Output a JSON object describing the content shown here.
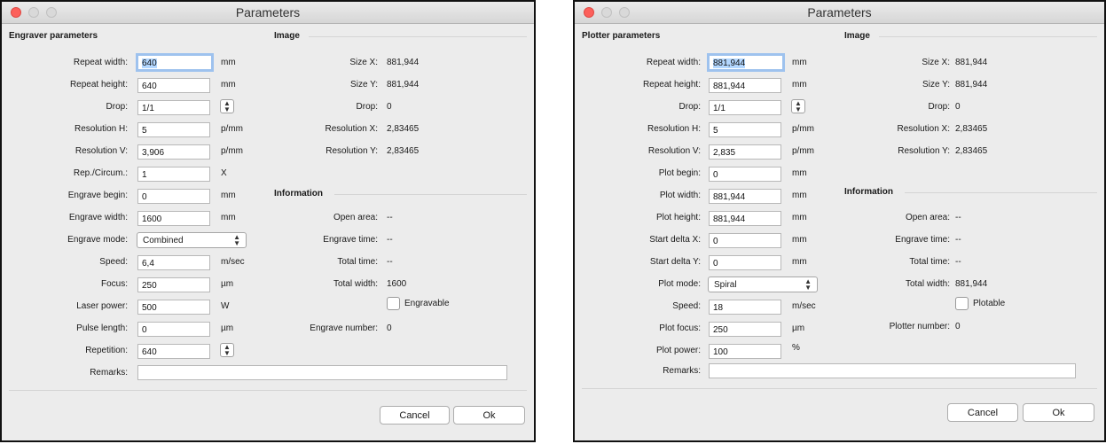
{
  "engraver": {
    "title": "Parameters",
    "left_section": "Engraver parameters",
    "image_section": "Image",
    "info_section": "Information",
    "fields": [
      {
        "label": "Repeat width:",
        "value": "640",
        "unit": "mm"
      },
      {
        "label": "Repeat height:",
        "value": "640",
        "unit": "mm"
      },
      {
        "label": "Drop:",
        "value": "1/1",
        "unit": ""
      },
      {
        "label": "Resolution H:",
        "value": "5",
        "unit": "p/mm"
      },
      {
        "label": "Resolution V:",
        "value": "3,906",
        "unit": "p/mm"
      },
      {
        "label": "Rep./Circum.:",
        "value": "1",
        "unit": "X"
      },
      {
        "label": "Engrave begin:",
        "value": "0",
        "unit": "mm"
      },
      {
        "label": "Engrave width:",
        "value": "1600",
        "unit": "mm"
      },
      {
        "label": "Engrave mode:",
        "value": "Combined",
        "unit": ""
      },
      {
        "label": "Speed:",
        "value": "6,4",
        "unit": "m/sec"
      },
      {
        "label": "Focus:",
        "value": "250",
        "unit": "µm"
      },
      {
        "label": "Laser power:",
        "value": "500",
        "unit": "W"
      },
      {
        "label": "Pulse length:",
        "value": "0",
        "unit": "µm"
      },
      {
        "label": "Repetition:",
        "value": "640",
        "unit": ""
      }
    ],
    "remarks_label": "Remarks:",
    "image_info": [
      {
        "label": "Size X:",
        "value": "881,944"
      },
      {
        "label": "Size Y:",
        "value": "881,944"
      },
      {
        "label": "Drop:",
        "value": "0"
      },
      {
        "label": "Resolution X:",
        "value": "2,83465"
      },
      {
        "label": "Resolution Y:",
        "value": "2,83465"
      }
    ],
    "info": [
      {
        "label": "Open area:",
        "value": "--"
      },
      {
        "label": "Engrave time:",
        "value": "--"
      },
      {
        "label": "Total time:",
        "value": "--"
      },
      {
        "label": "Total width:",
        "value": "1600"
      }
    ],
    "checkbox_label": "Engravable",
    "number_label": "Engrave number:",
    "number_value": "0",
    "cancel": "Cancel",
    "ok": "Ok"
  },
  "plotter": {
    "title": "Parameters",
    "left_section": "Plotter parameters",
    "image_section": "Image",
    "info_section": "Information",
    "fields": [
      {
        "label": "Repeat width:",
        "value": "881,944",
        "unit": "mm"
      },
      {
        "label": "Repeat height:",
        "value": "881,944",
        "unit": "mm"
      },
      {
        "label": "Drop:",
        "value": "1/1",
        "unit": ""
      },
      {
        "label": "Resolution H:",
        "value": "5",
        "unit": "p/mm"
      },
      {
        "label": "Resolution V:",
        "value": "2,835",
        "unit": "p/mm"
      },
      {
        "label": "Plot begin:",
        "value": "0",
        "unit": "mm"
      },
      {
        "label": "Plot width:",
        "value": "881,944",
        "unit": "mm"
      },
      {
        "label": "Plot height:",
        "value": "881,944",
        "unit": "mm"
      },
      {
        "label": "Start delta X:",
        "value": "0",
        "unit": "mm"
      },
      {
        "label": "Start delta Y:",
        "value": "0",
        "unit": "mm"
      },
      {
        "label": "Plot mode:",
        "value": "Spiral",
        "unit": ""
      },
      {
        "label": "Speed:",
        "value": "18",
        "unit": "m/sec"
      },
      {
        "label": "Plot focus:",
        "value": "250",
        "unit": "µm"
      },
      {
        "label": "Plot power:",
        "value": "100",
        "unit": "%"
      }
    ],
    "remarks_label": "Remarks:",
    "image_info": [
      {
        "label": "Size X:",
        "value": "881,944"
      },
      {
        "label": "Size Y:",
        "value": "881,944"
      },
      {
        "label": "Drop:",
        "value": "0"
      },
      {
        "label": "Resolution X:",
        "value": "2,83465"
      },
      {
        "label": "Resolution Y:",
        "value": "2,83465"
      }
    ],
    "info": [
      {
        "label": "Open area:",
        "value": "--"
      },
      {
        "label": "Engrave time:",
        "value": "--"
      },
      {
        "label": "Total time:",
        "value": "--"
      },
      {
        "label": "Total width:",
        "value": "881,944"
      }
    ],
    "checkbox_label": "Plotable",
    "number_label": "Plotter number:",
    "number_value": "0",
    "cancel": "Cancel",
    "ok": "Ok"
  }
}
